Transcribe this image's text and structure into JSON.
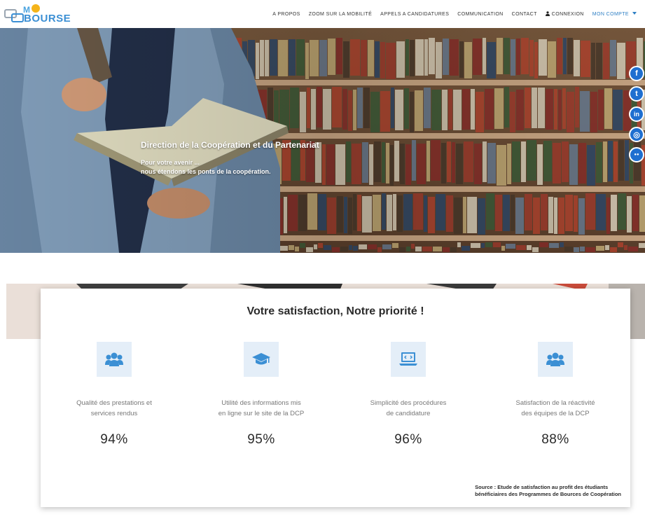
{
  "brand": {
    "m": "M",
    "word": "BOURSE"
  },
  "nav": {
    "items": [
      "A PROPOS",
      "ZOOM SUR LA MOBILITÉ",
      "APPELS A CANDIDATURES",
      "COMMUNICATION",
      "CONTACT"
    ],
    "login": "CONNEXION",
    "account": "MON COMPTE"
  },
  "hero": {
    "title": "Direction de la Coopération et du Partenariat",
    "subtitle_line1": "Pour votre avenir ...",
    "subtitle_line2": "nous étendons les ponts de la coopération."
  },
  "social": [
    {
      "icon": "facebook-icon",
      "glyph": "f"
    },
    {
      "icon": "twitter-icon",
      "glyph": "t"
    },
    {
      "icon": "linkedin-icon",
      "glyph": "in"
    },
    {
      "icon": "instagram-icon",
      "glyph": "◎"
    },
    {
      "icon": "flickr-icon",
      "glyph": "●●"
    }
  ],
  "satisfaction": {
    "heading": "Votre satisfaction, Notre priorité !",
    "stats": [
      {
        "icon": "users-icon",
        "label_line1": "Qualité des prestations et",
        "label_line2": "services rendus",
        "value": "94%"
      },
      {
        "icon": "graduation-cap-icon",
        "label_line1": "Utilité des informations mis",
        "label_line2": "en ligne sur le site de la DCP",
        "value": "95%"
      },
      {
        "icon": "laptop-code-icon",
        "label_line1": "Simplicité des procédures",
        "label_line2": "de candidature",
        "value": "96%"
      },
      {
        "icon": "users-icon",
        "label_line1": "Satisfaction de la réactivité",
        "label_line2": "des équipes de la DCP",
        "value": "88%"
      }
    ],
    "source_line1": "Source : Etude de satisfaction au profit des étudiants",
    "source_line2": "bénéficiaires des Programmes de Bources de Coopération"
  },
  "colors": {
    "accent": "#2e7fc4",
    "icon_bg": "#e4eef8",
    "icon_fg": "#3b8fd4"
  }
}
